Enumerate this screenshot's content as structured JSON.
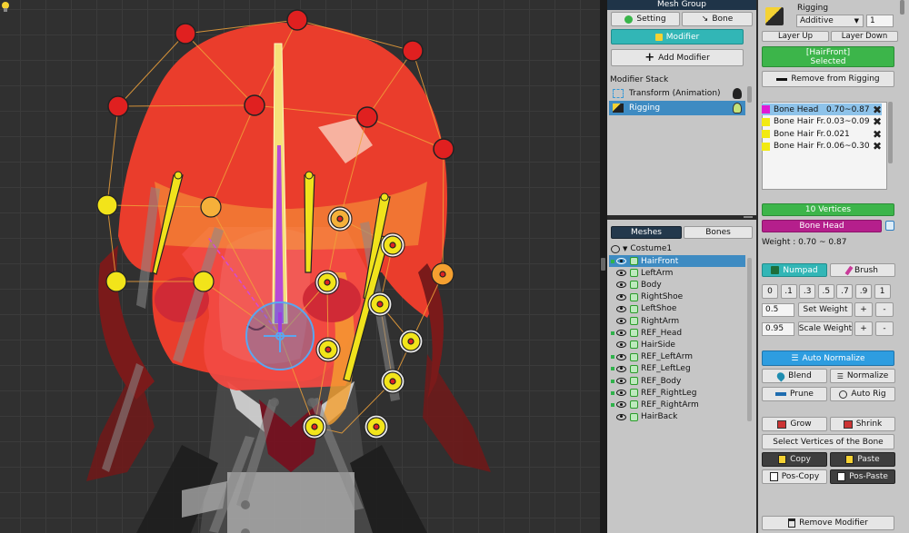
{
  "colors": {
    "selected_row": "#3e8bc2",
    "teal": "#32b6b6",
    "green": "#3cb54a",
    "magenta": "#b51f8c",
    "header": "#1f3448",
    "hair_red": "#e8392b",
    "bone_yellow": "#f0e21c"
  },
  "left": {
    "mesh_group_title": "Mesh Group",
    "tabs": {
      "setting": "Setting",
      "bone": "Bone",
      "modifier": "Modifier"
    },
    "add_modifier": "Add Modifier",
    "modifier_stack_label": "Modifier Stack",
    "modifiers": [
      {
        "label": "Transform (Animation)"
      },
      {
        "label": "Rigging"
      }
    ],
    "mesh_tabs": {
      "meshes": "Meshes",
      "bones": "Bones"
    },
    "root": "Costume1",
    "meshes": [
      {
        "name": "HairFront",
        "selected": true,
        "flag": true
      },
      {
        "name": "LeftArm",
        "flag": false
      },
      {
        "name": "Body",
        "flag": false
      },
      {
        "name": "RightShoe",
        "flag": false
      },
      {
        "name": "LeftShoe",
        "flag": false
      },
      {
        "name": "RightArm",
        "flag": false
      },
      {
        "name": "REF_Head",
        "flag": true
      },
      {
        "name": "HairSide",
        "flag": false
      },
      {
        "name": "REF_LeftArm",
        "flag": true
      },
      {
        "name": "REF_LeftLeg",
        "flag": true
      },
      {
        "name": "REF_Body",
        "flag": true
      },
      {
        "name": "REF_RightLeg",
        "flag": true
      },
      {
        "name": "REF_RightArm",
        "flag": true
      },
      {
        "name": "HairBack",
        "flag": false
      }
    ]
  },
  "right": {
    "title": "Rigging",
    "blend_mode": "Additive",
    "layer_value": "1",
    "layer_up": "Layer Up",
    "layer_down": "Layer Down",
    "selected_line1": "[HairFront]",
    "selected_line2": "Selected",
    "remove_from_rigging": "Remove from Rigging",
    "bones": [
      {
        "name": "Bone Head",
        "weight": "0.70~0.87",
        "color": "#e01ad6",
        "selected": true
      },
      {
        "name": "Bone Hair Fr...",
        "weight": "0.03~0.09",
        "color": "#f2ea12"
      },
      {
        "name": "Bone Hair Fr...",
        "weight": "0.021",
        "color": "#f2ea12"
      },
      {
        "name": "Bone Hair Fr...",
        "weight": "0.06~0.30",
        "color": "#f2ea12"
      }
    ],
    "vertices_count": "10 Vertices",
    "active_bone": "Bone Head",
    "weight_readout": "Weight : 0.70 ~ 0.87",
    "numpad": "Numpad",
    "brush": "Brush",
    "presets": [
      "0",
      ".1",
      ".3",
      ".5",
      ".7",
      ".9",
      "1"
    ],
    "set_weight_value": "0.5",
    "set_weight": "Set Weight",
    "scale_weight_value": "0.95",
    "scale_weight": "Scale Weight",
    "plus": "+",
    "minus": "-",
    "auto_normalize": "Auto Normalize",
    "blend": "Blend",
    "normalize": "Normalize",
    "prune": "Prune",
    "auto_rig": "Auto Rig",
    "grow": "Grow",
    "shrink": "Shrink",
    "select_vertices": "Select Vertices of the Bone",
    "copy": "Copy",
    "paste": "Paste",
    "pos_copy": "Pos-Copy",
    "pos_paste": "Pos-Paste",
    "remove_modifier": "Remove Modifier"
  }
}
